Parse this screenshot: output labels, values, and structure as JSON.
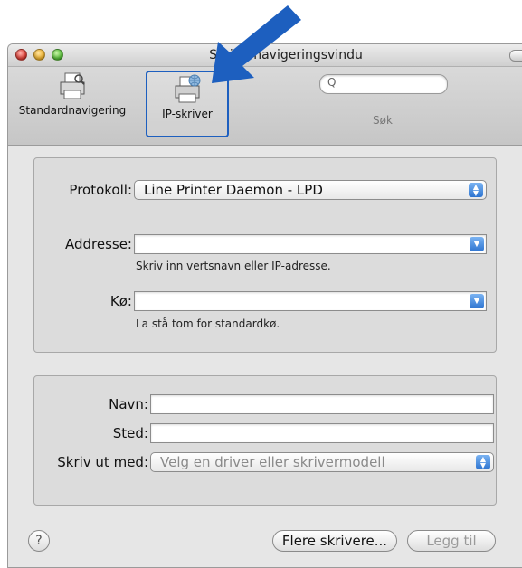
{
  "window": {
    "title": "Skrivernavigeringsvindu"
  },
  "toolbar": {
    "std_label": "Standardnavigering",
    "ip_label": "IP-skriver",
    "search_glyph": "Q",
    "search_label": "Søk"
  },
  "form": {
    "protocol_label": "Protokoll:",
    "protocol_value": "Line Printer Daemon - LPD",
    "address_label": "Addresse:",
    "address_value": "",
    "address_hint": "Skriv inn vertsnavn eller IP-adresse.",
    "queue_label": "Kø:",
    "queue_value": "",
    "queue_hint": "La stå tom for standardkø."
  },
  "details": {
    "name_label": "Navn:",
    "location_label": "Sted:",
    "print_using_label": "Skriv ut med:",
    "print_using_value": "Velg en driver eller skrivermodell"
  },
  "footer": {
    "help_label": "?",
    "more_printers_label": "Flere skrivere...",
    "add_label": "Legg til"
  },
  "colors": {
    "arrow": "#1d5fbf",
    "highlight_border": "#1d5fbf"
  }
}
